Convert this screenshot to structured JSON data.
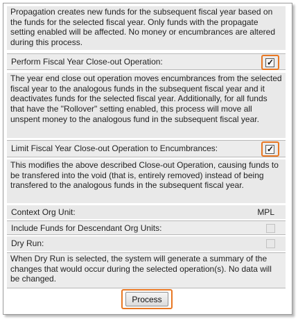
{
  "descriptions": {
    "propagation": "Propagation creates new funds for the subsequent fiscal year based on the funds for the selected fiscal year. Only funds with the propagate setting enabled will be affected. No money or encumbrances are altered during this process.",
    "close_out": "The year end close out operation moves encumbrances from the selected fiscal year to the analogous funds in the subsequent fiscal year and it deactivates funds for the selected fiscal year. Additionally, for all funds that have the \"Rollover\" setting enabled, this process will move all unspent money to the analogous fund in the subsequent fiscal year.",
    "limit_close_out": "This modifies the above described Close-out Operation, causing funds to be transfered into the void (that is, entirely removed) instead of being transfered to the analogous funds in the subsequent fiscal year.",
    "dry_run": "When Dry Run is selected, the system will generate a summary of the changes that would occur during the selected operation(s). No data will be changed."
  },
  "options": {
    "close_out": {
      "label": "Perform Fiscal Year Close-out Operation:",
      "checked": true
    },
    "limit_to_encumbrances": {
      "label": "Limit Fiscal Year Close-out Operation to Encumbrances:",
      "checked": true
    },
    "context_org_unit": {
      "label": "Context Org Unit:",
      "value": "MPL"
    },
    "include_descendants": {
      "label": "Include Funds for Descendant Org Units:",
      "checked": false
    },
    "dry_run": {
      "label": "Dry Run:",
      "checked": false
    }
  },
  "actions": {
    "process_label": "Process"
  },
  "colors": {
    "highlight": "#e87722",
    "panel_background": "#e9e9e9"
  }
}
